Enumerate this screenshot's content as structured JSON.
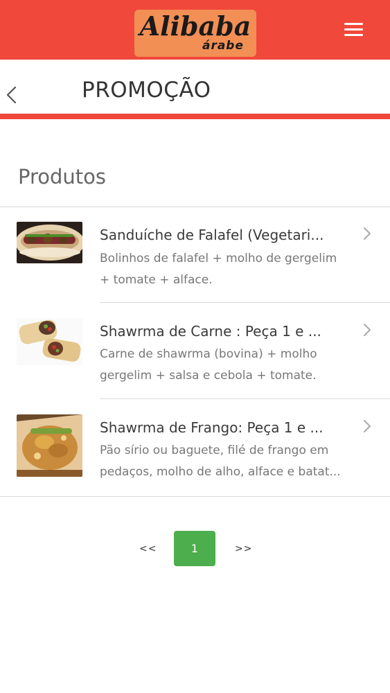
{
  "header": {
    "logo_main": "Alibaba",
    "logo_sub": "árabe",
    "menu_icon": "hamburger-menu-icon",
    "bar_color": "#f0483a",
    "logo_bg": "#f28f55"
  },
  "titlebar": {
    "title": "PROMOÇÃO",
    "back_icon": "chevron-left-icon"
  },
  "section": {
    "title": "Produtos"
  },
  "products": [
    {
      "title": "Sanduíche de Falafel (Vegetari...",
      "desc_line1": "Bolinhos de falafel + molho de gergelim",
      "desc_line2": "+ tomate + alface.",
      "chevron_icon": "chevron-right-icon"
    },
    {
      "title": "Shawrma de Carne : Peça 1 e ...",
      "desc_line1": "Carne de shawrma (bovina) + molho",
      "desc_line2": "gergelim + salsa e cebola + tomate.",
      "chevron_icon": "chevron-right-icon"
    },
    {
      "title": "Shawrma de Frango: Peça 1 e ...",
      "desc_line1": "Pão sírio ou baguete, filé de frango em",
      "desc_line2": "pedaços, molho de alho, alface e batat...",
      "chevron_icon": "chevron-right-icon"
    }
  ],
  "pagination": {
    "prev": "<<",
    "current": "1",
    "next": ">>",
    "active_color": "#4cae4c"
  }
}
